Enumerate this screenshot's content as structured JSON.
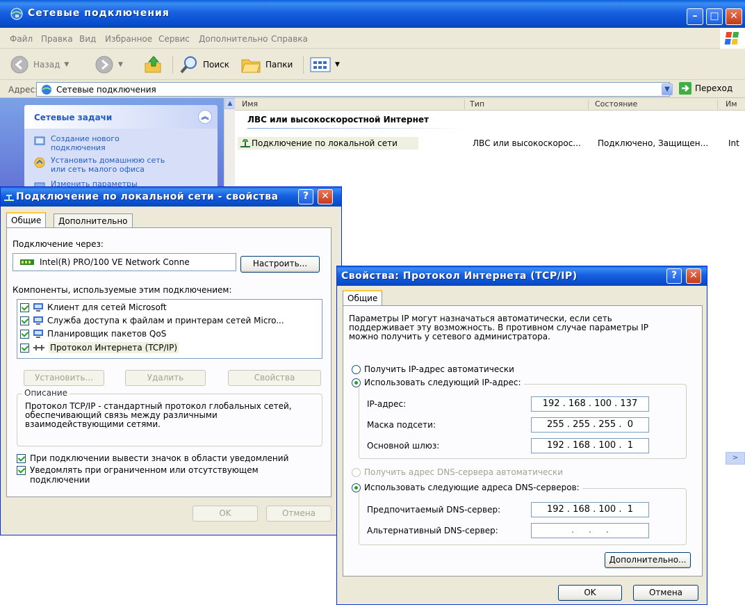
{
  "explorer": {
    "title": "Сетевые подключения",
    "menu": [
      "Файл",
      "Правка",
      "Вид",
      "Избранное",
      "Сервис",
      "Дополнительно",
      "Справка"
    ],
    "toolbar": {
      "back": "Назад",
      "search": "Поиск",
      "folders": "Папки"
    },
    "address": {
      "label": "Адрес:",
      "value": "Сетевые подключения",
      "go": "Переход"
    },
    "tasks": {
      "title": "Сетевые задачи",
      "items": [
        "Создание нового подключения",
        "Установить домашнюю сеть или сеть малого офиса",
        "Изменить параметры"
      ]
    },
    "columns": [
      "Имя",
      "Тип",
      "Состояние",
      "Им"
    ],
    "group": "ЛВС или высокоскоростной Интернет",
    "row": {
      "name": "Подключение по локальной сети",
      "type": "ЛВС или высокоскорос...",
      "status": "Подключено, Защищен...",
      "extra": "Int"
    }
  },
  "lan_dialog": {
    "title": "Подключение по локальной сети - свойства",
    "tabs": [
      "Общие",
      "Дополнительно"
    ],
    "connect_via_label": "Подключение через:",
    "adapter": "Intel(R) PRO/100 VE Network Conne",
    "configure": "Настроить...",
    "components_label": "Компоненты, используемые этим подключением:",
    "components": [
      "Клиент для сетей Microsoft",
      "Служба доступа к файлам и принтерам сетей Micro...",
      "Планировщик пакетов QoS",
      "Протокол Интернета (TCP/IP)"
    ],
    "install": "Установить...",
    "remove": "Удалить",
    "properties": "Свойства",
    "description_label": "Описание",
    "description": "Протокол TCP/IP - стандартный протокол глобальных сетей, обеспечивающий связь между различными взаимодействующими сетями.",
    "show_icon": "При подключении вывести значок в области уведомлений",
    "notify": "Уведомлять при ограниченном или отсутствующем подключении",
    "ok": "OK",
    "cancel": "Отмена"
  },
  "tcp_dialog": {
    "title": "Свойства: Протокол Интернета (TCP/IP)",
    "tab": "Общие",
    "intro": "Параметры IP могут назначаться автоматически, если сеть поддерживает эту возможность. В противном случае параметры IP можно получить у сетевого администратора.",
    "auto_ip": "Получить IP-адрес автоматически",
    "manual_ip": "Использовать следующий IP-адрес:",
    "ip_label": "IP-адрес:",
    "ip_value": "192 . 168 . 100 . 137",
    "mask_label": "Маска подсети:",
    "mask_value": "255 . 255 . 255 .  0",
    "gateway_label": "Основной шлюз:",
    "gateway_value": "192 . 168 . 100 .  1",
    "auto_dns": "Получить адрес DNS-сервера автоматически",
    "manual_dns": "Использовать следующие адреса DNS-серверов:",
    "pref_dns_label": "Предпочитаемый DNS-сервер:",
    "pref_dns_value": "192 . 168 . 100 .  1",
    "alt_dns_label": "Альтернативный DNS-сервер:",
    "alt_dns_value": "   .     .     .   ",
    "advanced": "Дополнительно...",
    "ok": "OK",
    "cancel": "Отмена"
  }
}
